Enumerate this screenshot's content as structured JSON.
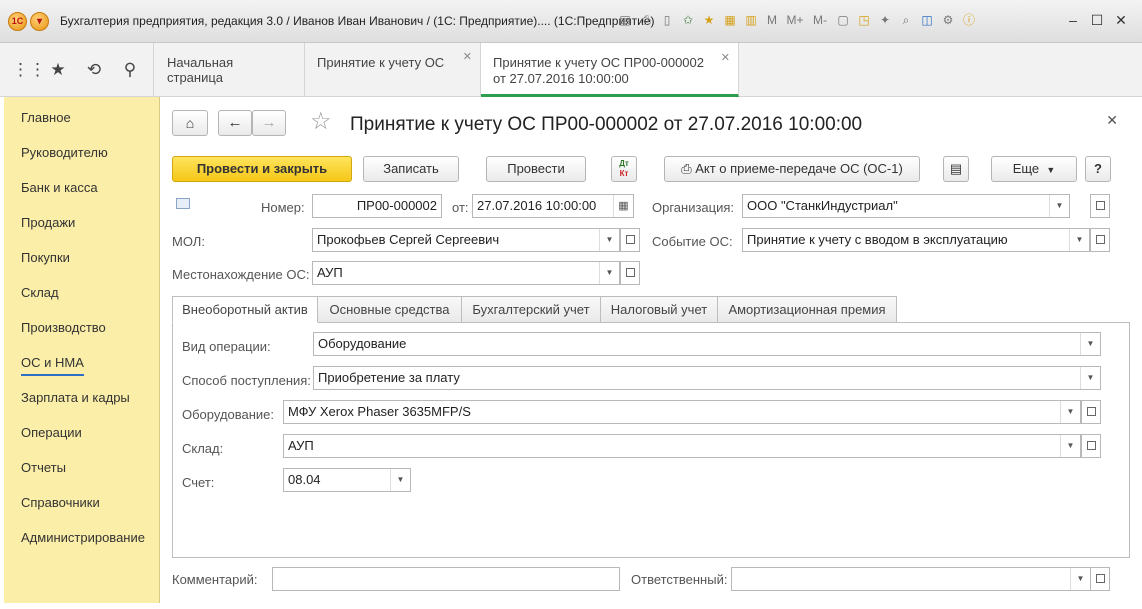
{
  "titlebar": {
    "title": "Бухгалтерия предприятия, редакция 3.0 / Иванов Иван Иванович / (1С: Предприятие)....  (1С:Предприятие)",
    "toolbar_icons": [
      "save-icon",
      "print-icon",
      "preview-icon",
      "favorites-icon",
      "star-icon",
      "calculator-icon",
      "calendar-icon",
      "memory-m",
      "memory-m-plus",
      "memory-m-minus",
      "new-window-icon",
      "pin-icon",
      "back-icon",
      "search-icon",
      "layout-icon",
      "settings-icon",
      "info-icon"
    ],
    "mem_labels": [
      "M",
      "M+",
      "M-"
    ]
  },
  "open_tabs": [
    {
      "label": "Начальная страница",
      "closable": false
    },
    {
      "label": "Принятие к учету ОС",
      "closable": true
    },
    {
      "label": "Принятие к учету ОС ПР00-000002 от 27.07.2016 10:00:00",
      "label_line1": "Принятие к учету ОС ПР00-000002",
      "label_line2": "от 27.07.2016 10:00:00",
      "closable": true,
      "active": true
    }
  ],
  "sidebar": {
    "items": [
      {
        "label": "Главное"
      },
      {
        "label": "Руководителю"
      },
      {
        "label": "Банк и касса"
      },
      {
        "label": "Продажи"
      },
      {
        "label": "Покупки"
      },
      {
        "label": "Склад"
      },
      {
        "label": "Производство"
      },
      {
        "label": "ОС и НМА",
        "active": true
      },
      {
        "label": "Зарплата и кадры"
      },
      {
        "label": "Операции"
      },
      {
        "label": "Отчеты"
      },
      {
        "label": "Справочники"
      },
      {
        "label": "Администрирование"
      }
    ]
  },
  "form": {
    "title": "Принятие к учету ОС ПР00-000002 от 27.07.2016 10:00:00",
    "buttons": {
      "post_close": "Провести и закрыть",
      "save": "Записать",
      "post": "Провести",
      "dtkt_top": "Дт",
      "dtkt_bottom": "Кт",
      "act": "Акт о приеме-передаче ОС (ОС-1)",
      "more": "Еще",
      "help": "?"
    },
    "number_label": "Номер:",
    "number": "ПР00-000002",
    "date_label": "от:",
    "date": "27.07.2016 10:00:00",
    "org_label": "Организация:",
    "org": "ООО \"СтанкИндустриал\"",
    "mol_label": "МОЛ:",
    "mol": "Прокофьев Сергей Сергеевич",
    "event_label": "Событие ОС:",
    "event": "Принятие к учету с вводом в эксплуатацию",
    "location_label": "Местонахождение ОС:",
    "location": "АУП",
    "tabs": [
      "Внеоборотный актив",
      "Основные средства",
      "Бухгалтерский учет",
      "Налоговый учет",
      "Амортизационная премия"
    ],
    "active_tab": 0,
    "tab0": {
      "op_type_label": "Вид операции:",
      "op_type": "Оборудование",
      "method_label": "Способ поступления:",
      "method": "Приобретение за плату",
      "equipment_label": "Оборудование:",
      "equipment": "МФУ Xerox Phaser 3635MFP/S",
      "warehouse_label": "Склад:",
      "warehouse": "АУП",
      "account_label": "Счет:",
      "account": "08.04"
    },
    "comment_label": "Комментарий:",
    "comment": "",
    "responsible_label": "Ответственный:",
    "responsible": ""
  },
  "colors": {
    "sidebar_bg": "#fbeea8",
    "primary_btn": "#f5c717",
    "active_tab_underline": "#2e9e4e",
    "active_nav_underline": "#2d6fc4"
  }
}
